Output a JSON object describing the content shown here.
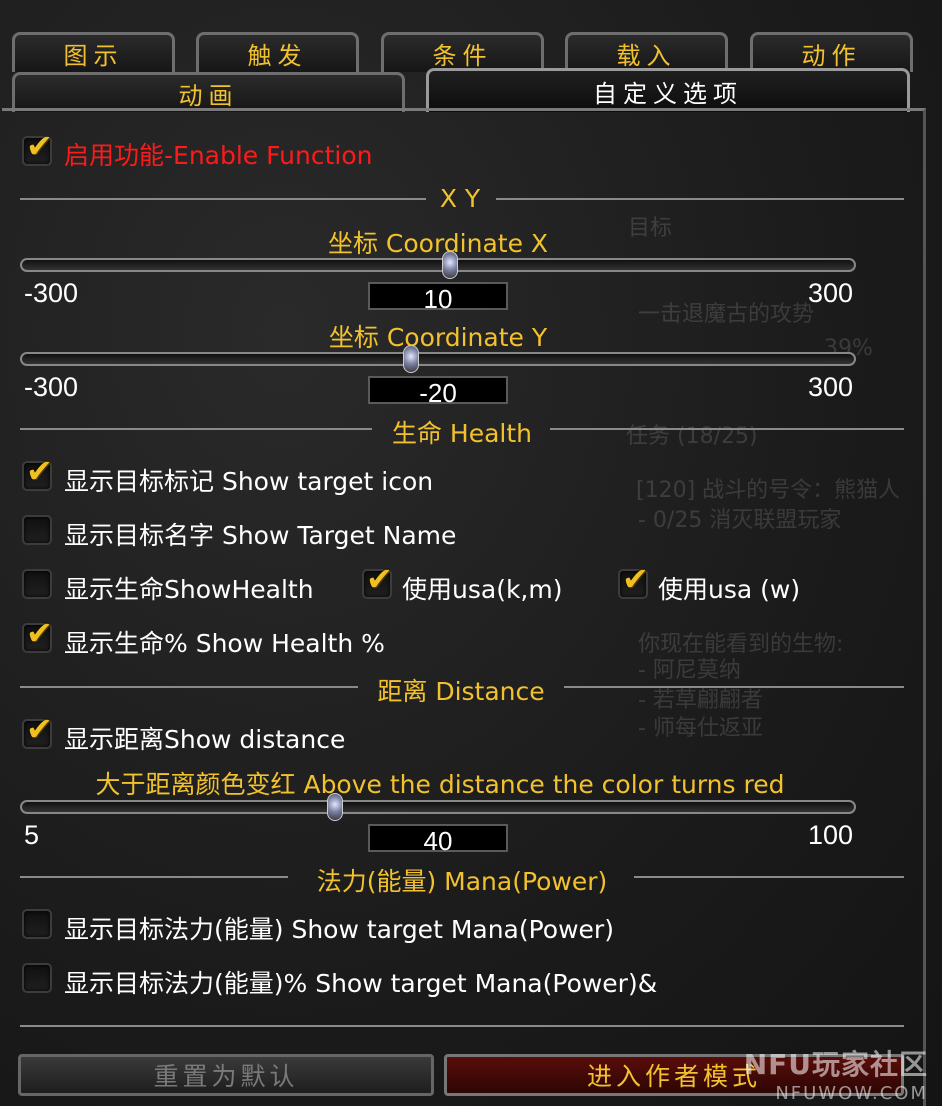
{
  "tabs_row1": [
    "图示",
    "触发",
    "条件",
    "载入",
    "动作"
  ],
  "tabs_row2": [
    "动画",
    "自定义选项"
  ],
  "enable": {
    "label": "启用功能-Enable Function",
    "checked": true
  },
  "section_xy": "X Y",
  "coord_x": {
    "label": "坐标 Coordinate X",
    "min": "-300",
    "max": "300",
    "value": "10",
    "fraction": 0.517
  },
  "coord_y": {
    "label": "坐标 Coordinate Y",
    "min": "-300",
    "max": "300",
    "value": "-20",
    "fraction": 0.467
  },
  "section_health": "生命 Health",
  "show_target_icon": {
    "label": "显示目标标记 Show target icon",
    "checked": true
  },
  "show_target_name": {
    "label": "显示目标名字 Show Target Name",
    "checked": false
  },
  "show_health": {
    "label": "显示生命ShowHealth",
    "checked": false
  },
  "usa_km": {
    "label": "使用usa(k,m)",
    "checked": true
  },
  "usa_w": {
    "label": "使用usa (w)",
    "checked": true
  },
  "show_health_pct": {
    "label": "显示生命% Show Health %",
    "checked": true
  },
  "section_distance": "距离 Distance",
  "show_distance": {
    "label": "显示距离Show distance",
    "checked": true
  },
  "distance_red": {
    "label": "大于距离颜色变红 Above the distance the color turns red",
    "min": "5",
    "max": "100",
    "value": "40",
    "fraction": 0.368
  },
  "section_mana": "法力(能量) Mana(Power)",
  "show_mana": {
    "label": "显示目标法力(能量) Show target Mana(Power)",
    "checked": false
  },
  "show_mana_pct": {
    "label": "显示目标法力(能量)% Show target Mana(Power)&",
    "checked": false
  },
  "buttons": {
    "reset": "重置为默认",
    "author": "进入作者模式"
  },
  "background_ghost_text": [
    "目标",
    "一击退魔古的攻势",
    "39%",
    "任务 (18/25)",
    "[120] 战斗的号令：熊猫人",
    "- 0/25 消灭联盟玩家",
    "你现在能看到的生物:",
    "- 阿尼莫纳",
    "- 若草翩翩者",
    "- 师每仕返亚"
  ],
  "watermark": {
    "line1": "NFU玩家社区",
    "line2": "NFUWOW.COM"
  },
  "colors": {
    "accent": "#f2c12e",
    "red": "#ff1a1a",
    "check": "#f0c020"
  },
  "icons": {
    "checkmark": "check-icon"
  }
}
